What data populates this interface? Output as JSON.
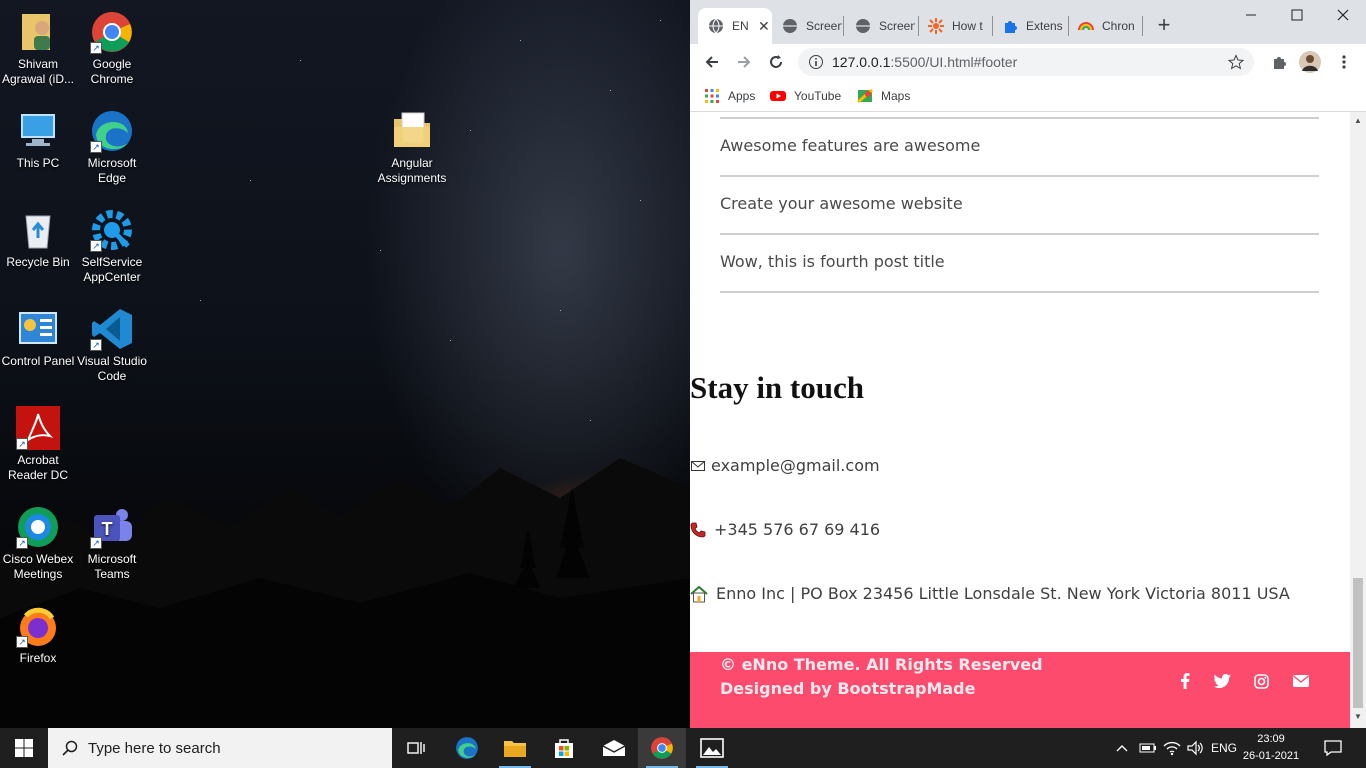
{
  "desktop": {
    "icons": [
      {
        "label": "Shivam Agrawal (iD..."
      },
      {
        "label": "Google Chrome"
      },
      {
        "label": "This PC"
      },
      {
        "label": "Microsoft Edge"
      },
      {
        "label": "Angular Assignments"
      },
      {
        "label": "Recycle Bin"
      },
      {
        "label": "SelfService AppCenter"
      },
      {
        "label": "Control Panel"
      },
      {
        "label": "Visual Studio Code"
      },
      {
        "label": "Acrobat Reader DC"
      },
      {
        "label": "Cisco Webex Meetings"
      },
      {
        "label": "Microsoft Teams"
      },
      {
        "label": "Firefox"
      }
    ]
  },
  "browser": {
    "tabs": [
      {
        "label": "EN",
        "active": true
      },
      {
        "label": "Screen"
      },
      {
        "label": "Screen"
      },
      {
        "label": "How t"
      },
      {
        "label": "Extens"
      },
      {
        "label": "Chron"
      }
    ],
    "url_host": "127.0.0.1",
    "url_rest": ":5500/UI.html#footer",
    "bookmarks": [
      {
        "label": "Apps"
      },
      {
        "label": "YouTube"
      },
      {
        "label": "Maps"
      }
    ]
  },
  "page": {
    "posts": [
      "Awesome features are awesome",
      "Create your awesome website",
      "Wow, this is fourth post title"
    ],
    "stay_title": "Stay in touch",
    "email": "example@gmail.com",
    "phone": "+345 576 67 69 416",
    "address": "Enno Inc | PO Box 23456 Little Lonsdale St. New York Victoria 8011 USA",
    "footer": {
      "copyright": "© eNno Theme. All Rights Reserved",
      "designed": "Designed by BootstrapMade",
      "social": [
        "facebook-icon",
        "twitter-icon",
        "instagram-icon",
        "envelope-icon"
      ]
    },
    "colors": {
      "footer_bg": "#fc4b6c"
    }
  },
  "taskbar": {
    "search_placeholder": "Type here to search",
    "language": "ENG",
    "time": "23:09",
    "date": "26-01-2021"
  }
}
